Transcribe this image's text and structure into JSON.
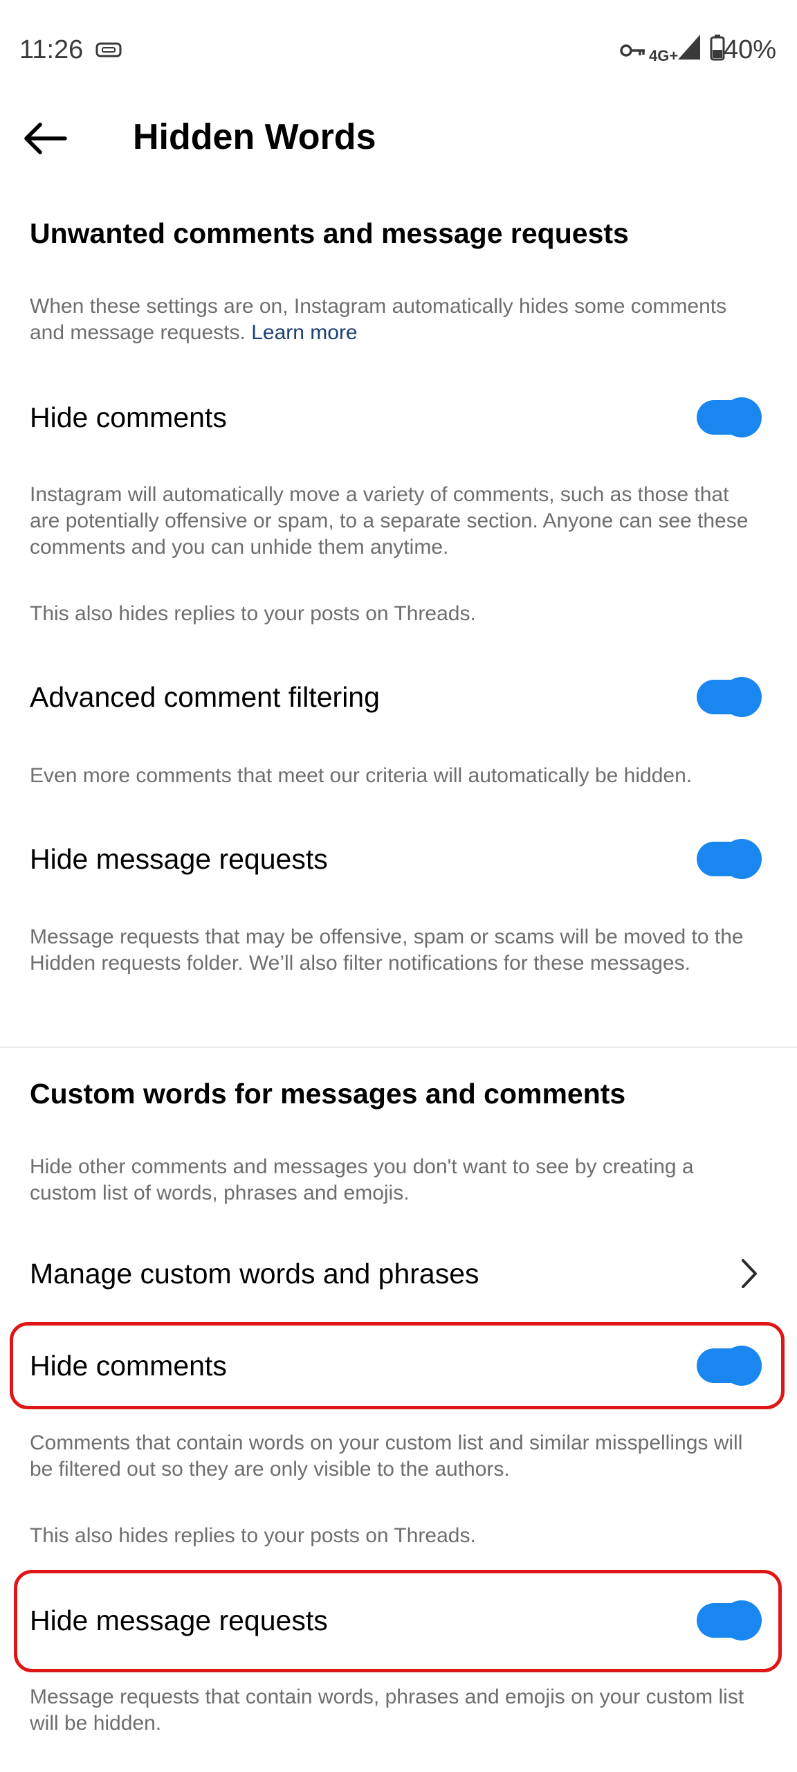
{
  "status_bar": {
    "time": "11:26",
    "network": "4G+",
    "battery": "40%"
  },
  "header": {
    "title": "Hidden Words"
  },
  "section1": {
    "title": "Unwanted comments and message requests",
    "description": "When these settings are on, Instagram automatically hides some comments and message requests.",
    "link": "Learn more",
    "items": [
      {
        "label": "Hide comments",
        "on": true,
        "description": "Instagram will automatically move a variety of comments, such as those that are potentially offensive or spam, to a separate section. Anyone can see these comments and you can unhide them anytime.",
        "extra": "This also hides replies to your posts on Threads."
      },
      {
        "label": "Advanced comment filtering",
        "on": true,
        "description": "Even more comments that meet our criteria will automatically be hidden."
      },
      {
        "label": "Hide message requests",
        "on": true,
        "description": "Message requests that may be offensive, spam or scams will be moved to the Hidden requests folder. We’ll also filter notifications for these messages."
      }
    ]
  },
  "section2": {
    "title": "Custom words for messages and comments",
    "description": "Hide other comments and messages you don't want to see by creating a custom list of words, phrases and emojis.",
    "manage_label": "Manage custom words and phrases",
    "items": [
      {
        "label": "Hide comments",
        "on": true,
        "description": "Comments that contain words on your custom list and similar misspellings will be filtered out so they are only visible to the authors.",
        "extra": "This also hides replies to your posts on Threads."
      },
      {
        "label": "Hide message requests",
        "on": true,
        "description": "Message requests that contain words, phrases and emojis on your custom list will be hidden."
      }
    ]
  },
  "colors": {
    "toggle_on": "#1a86f0",
    "highlight": "#e01616",
    "link": "#1b3f73"
  }
}
